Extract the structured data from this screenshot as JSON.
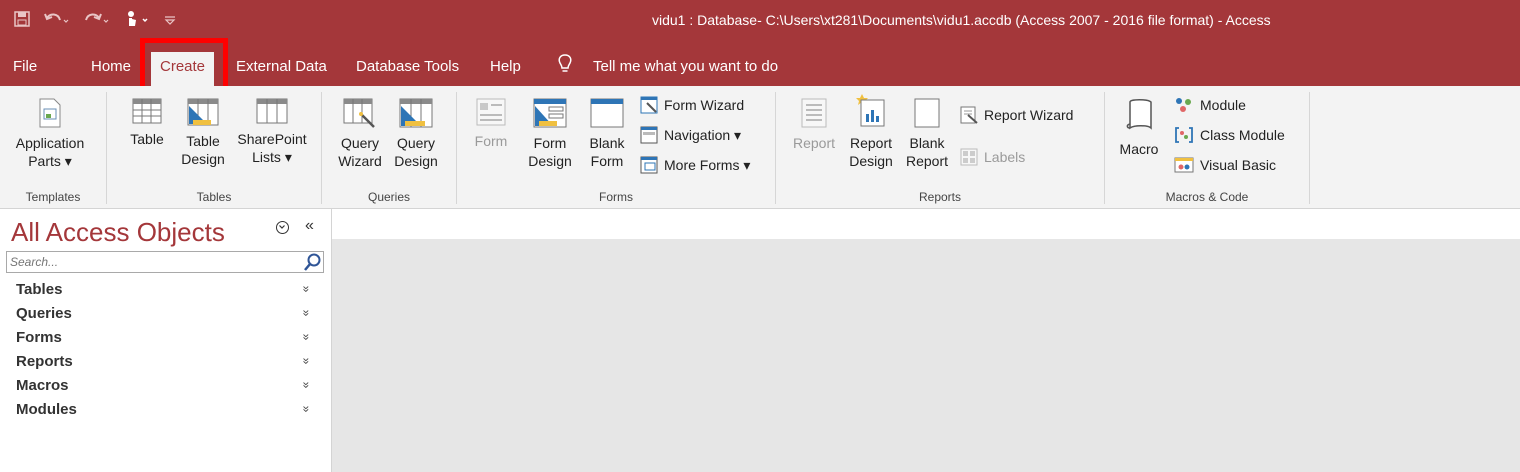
{
  "window": {
    "title": "vidu1 : Database- C:\\Users\\xt281\\Documents\\vidu1.accdb (Access 2007 - 2016 file format)  -  Access"
  },
  "qat": {
    "save_icon": "save-icon",
    "undo_icon": "undo-icon",
    "redo_icon": "redo-icon",
    "touch_icon": "touch-mode-icon",
    "customize_icon": "customize-qat-icon"
  },
  "tabs": [
    {
      "label": "File"
    },
    {
      "label": "Home"
    },
    {
      "label": "Create",
      "active": true
    },
    {
      "label": "External Data"
    },
    {
      "label": "Database Tools"
    },
    {
      "label": "Help"
    }
  ],
  "tell_me": "Tell me what you want to do",
  "ribbon": {
    "templates": {
      "label": "Templates",
      "application_parts": [
        "Application",
        "Parts ▾"
      ]
    },
    "tables": {
      "label": "Tables",
      "table": "Table",
      "table_design": [
        "Table",
        "Design"
      ],
      "sharepoint_lists": [
        "SharePoint",
        "Lists ▾"
      ]
    },
    "queries": {
      "label": "Queries",
      "query_wizard": [
        "Query",
        "Wizard"
      ],
      "query_design": [
        "Query",
        "Design"
      ]
    },
    "forms": {
      "label": "Forms",
      "form": "Form",
      "form_design": [
        "Form",
        "Design"
      ],
      "blank_form": [
        "Blank",
        "Form"
      ],
      "form_wizard": "Form Wizard",
      "navigation": "Navigation ▾",
      "more_forms": "More Forms ▾"
    },
    "reports": {
      "label": "Reports",
      "report": "Report",
      "report_design": [
        "Report",
        "Design"
      ],
      "blank_report": [
        "Blank",
        "Report"
      ],
      "report_wizard": "Report Wizard",
      "labels": "Labels"
    },
    "macros": {
      "label": "Macros & Code",
      "macro": "Macro",
      "module": "Module",
      "class_module": "Class Module",
      "visual_basic": "Visual Basic"
    }
  },
  "nav_pane": {
    "title": "All Access Objects",
    "search_placeholder": "Search...",
    "categories": [
      "Tables",
      "Queries",
      "Forms",
      "Reports",
      "Macros",
      "Modules"
    ]
  },
  "colors": {
    "accent": "#a4373a",
    "highlight": "#ff0000",
    "ribbon_bg": "#f3f3f3",
    "workspace_bg": "#e6e6e6"
  }
}
